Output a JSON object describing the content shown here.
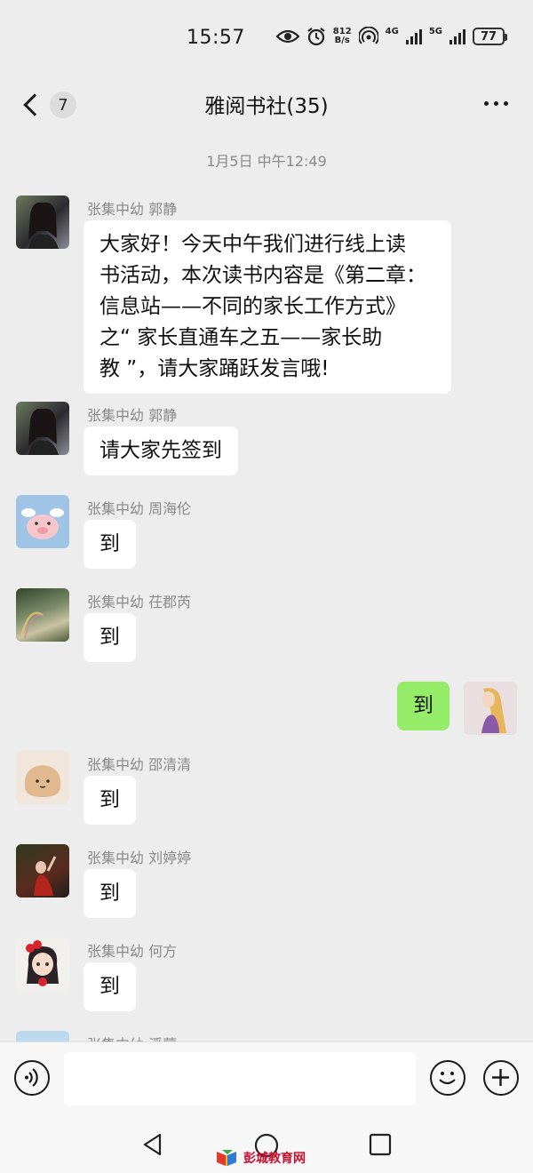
{
  "status_bar": {
    "time": "15:57",
    "speed_value": "812",
    "speed_unit": "B/s",
    "net_1": "4G",
    "net_2": "5G",
    "battery": "77"
  },
  "header": {
    "unread_count": "7",
    "title": "雅阅书社(35)"
  },
  "chat": {
    "timestamp": "1月5日 中午12:49",
    "messages": [
      {
        "sender": "张集中幼 郭静",
        "lines": [
          "大家好！今天中午我们进行线上读",
          "书活动，本次读书内容是《第二章：",
          "信息站——不同的家长工作方式》",
          "之“ 家长直通车之五——家长助",
          "教 ”，请大家踊跃发言哦!"
        ]
      },
      {
        "sender": "张集中幼 郭静",
        "text": "请大家先签到"
      },
      {
        "sender": "张集中幼 周海伦",
        "text": "到"
      },
      {
        "sender": "张集中幼 茌郡芮",
        "text": "到"
      },
      {
        "sender": "me",
        "text": "到"
      },
      {
        "sender": "张集中幼 邵清清",
        "text": "到"
      },
      {
        "sender": "张集中幼 刘婷婷",
        "text": "到"
      },
      {
        "sender": "张集中幼 何方",
        "text": "到"
      },
      {
        "sender": "张集中幼 潘蒙"
      }
    ]
  },
  "watermark": {
    "text": "彭城教育网"
  },
  "colors": {
    "background": "#ededed",
    "bubble_other": "#ffffff",
    "bubble_me": "#95ec69",
    "meta_text": "#8a8a8a"
  }
}
